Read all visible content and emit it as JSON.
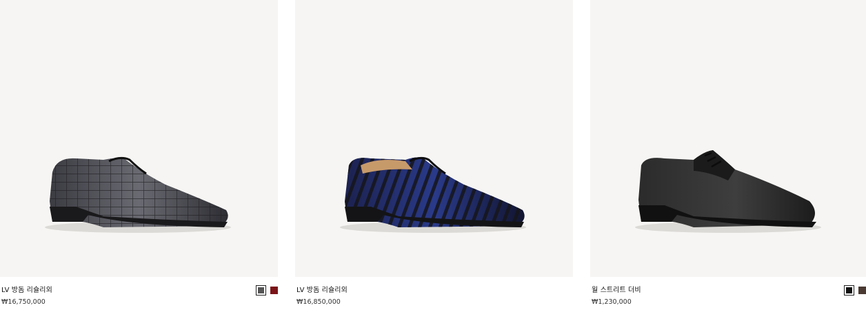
{
  "products": [
    {
      "name": "LV 방돔 리슐리외",
      "price": "₩16,750,000",
      "image_icon": "grey-alligator-richelieu-shoe",
      "swatches": [
        {
          "color": "#555555",
          "selected": true
        },
        {
          "color": "#7a1418",
          "selected": false
        }
      ]
    },
    {
      "name": "LV 방돔 리슐리외",
      "price": "₩16,850,000",
      "image_icon": "navy-alligator-richelieu-shoe",
      "swatches": []
    },
    {
      "name": "월 스트리트 더비",
      "price": "₩1,230,000",
      "image_icon": "black-leather-derby-shoe",
      "swatches": [
        {
          "color": "#111111",
          "selected": true
        },
        {
          "color": "#4a3a32",
          "selected": false
        }
      ]
    }
  ],
  "colors": {
    "image_background": "#f6f5f3",
    "text": "#111111"
  }
}
